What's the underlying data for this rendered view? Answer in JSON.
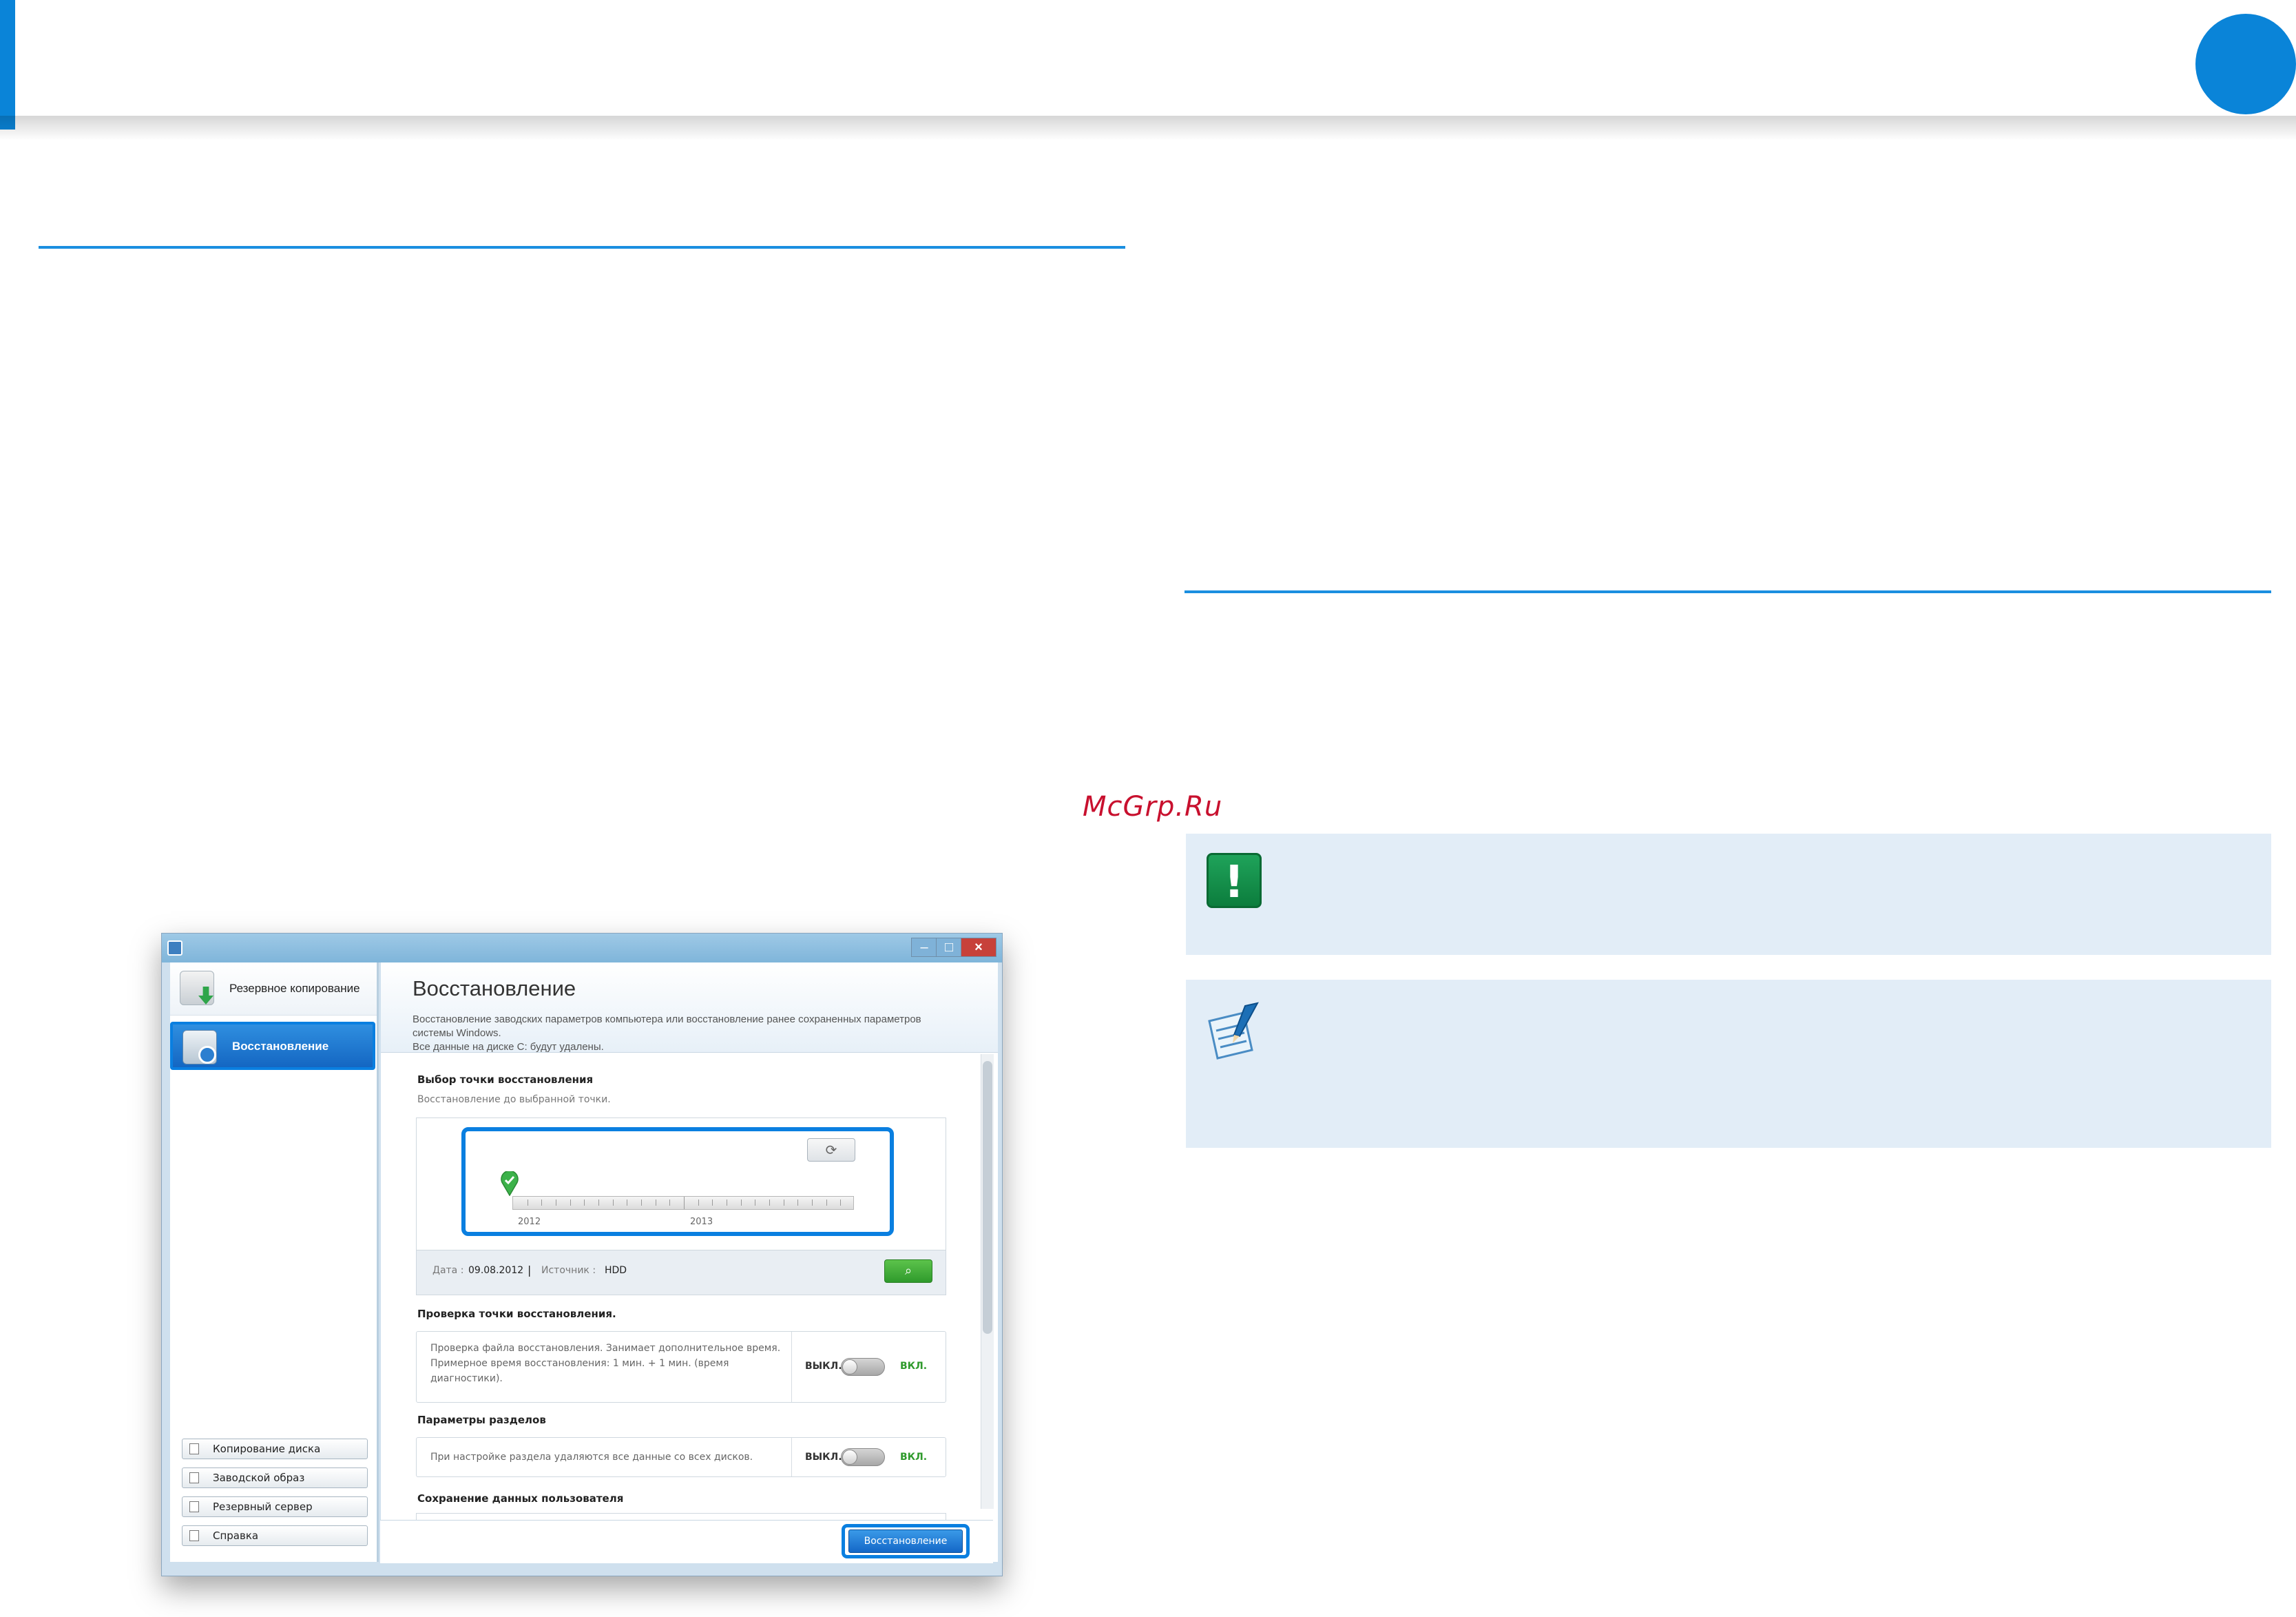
{
  "page": {
    "watermark": "McGrp.Ru",
    "colors": {
      "accent": "#0a84d8",
      "callout_bg": "#e2edf7",
      "warning_icon": "#1fa35a"
    },
    "icons": {
      "warning": "exclamation-icon",
      "note": "note-pen-icon"
    }
  },
  "app": {
    "sidebar": {
      "nav": [
        {
          "label": "Резервное копирование",
          "icon": "backup-icon"
        },
        {
          "label": "Восстановление",
          "icon": "restore-icon",
          "selected": true
        }
      ],
      "buttons": [
        {
          "label": "Копирование диска",
          "icon": "disk-copy-icon"
        },
        {
          "label": "Заводской образ",
          "icon": "factory-image-icon"
        },
        {
          "label": "Резервный сервер",
          "icon": "server-icon"
        },
        {
          "label": "Справка",
          "icon": "help-icon"
        }
      ]
    },
    "main": {
      "title": "Восстановление",
      "desc_line1": "Восстановление заводских параметров компьютера или восстановление ранее сохраненных параметров",
      "desc_line2": "системы Windows.",
      "desc_line3": "Все данные на диске C: будут удалены."
    },
    "restore_point": {
      "title": "Выбор точки восстановления",
      "subtitle": "Восстановление до выбранной точки.",
      "years": [
        "2012",
        "2013"
      ],
      "date_label": "Дата :",
      "date_value": "09.08.2012",
      "separator": "|",
      "source_label": "Источник :",
      "source_value": "HDD"
    },
    "verify": {
      "title": "Проверка точки восстановления.",
      "text_line1": "Проверка файла восстановления. Занимает дополнительное время.",
      "text_line2": "Примерное время восстановления: 1 мин. + 1 мин. (время",
      "text_line3": "диагностики).",
      "off": "ВЫКЛ.",
      "on": "ВКЛ.",
      "state": "off"
    },
    "partition": {
      "title": "Параметры разделов",
      "text": "При настройке раздела удаляются все данные со всех дисков.",
      "off": "ВЫКЛ.",
      "on": "ВКЛ.",
      "state": "off"
    },
    "user_data": {
      "title": "Сохранение данных пользователя"
    },
    "restore_button": "Восстановление"
  }
}
